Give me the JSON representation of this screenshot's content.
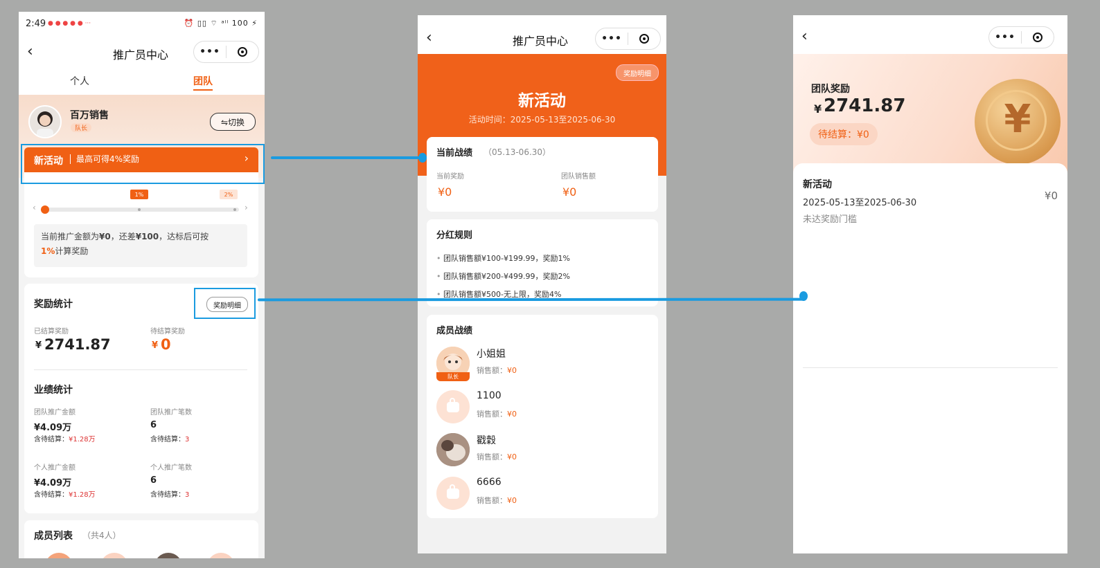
{
  "colors": {
    "accent": "#f06014",
    "highlight": "#1a9be0",
    "background": "#a9aaa9"
  },
  "p1": {
    "status_time": "2:49",
    "status_icons": "⏰ ▯▯ ⌔ ᵃˡˡ 100 ⚡",
    "nav": {
      "back_icon": "chevron-left-icon",
      "title": "推广员中心",
      "more": "•••"
    },
    "tabs": [
      {
        "label": "个人"
      },
      {
        "label": "团队"
      }
    ],
    "profile": {
      "name": "百万销售",
      "role_badge": "队长",
      "switch_label": "⇋切换"
    },
    "banner": {
      "title": "新活动",
      "subtitle": "最高可得4%奖励",
      "arrow": "›"
    },
    "progress": {
      "marker_1": "1%",
      "marker_2": "2%",
      "value": 0,
      "left_arrow": "‹",
      "right_arrow": "›"
    },
    "notice": {
      "line1_a": "当前推广金额为",
      "amount": "¥0",
      "line1_b": "，还差",
      "gap": "¥100",
      "line1_c": "，达标后可按",
      "rate": "1%",
      "line2": "计算奖励"
    },
    "reward_stats": {
      "title": "奖励统计",
      "detail_button": "奖励明细",
      "settled_label": "已结算奖励",
      "settled_currency": "¥",
      "settled_value": "2741.87",
      "pending_label": "待结算奖励",
      "pending_currency": "¥",
      "pending_value": "0"
    },
    "performance": {
      "title": "业绩统计",
      "team_amount_label": "团队推广金额",
      "team_amount": "¥4.09万",
      "team_amount_pending_label": "含待结算：",
      "team_amount_pending": "¥1.28万",
      "team_count_label": "团队推广笔数",
      "team_count": "6",
      "team_count_pending_label": "含待结算：",
      "team_count_pending": "3",
      "personal_amount_label": "个人推广金额",
      "personal_amount": "¥4.09万",
      "personal_amount_pending_label": "含待结算：",
      "personal_amount_pending": "¥1.28万",
      "personal_count_label": "个人推广笔数",
      "personal_count": "6",
      "personal_count_pending_label": "含待结算：",
      "personal_count_pending": "3"
    },
    "members": {
      "title": "成员列表",
      "count": "（共4人）"
    }
  },
  "p2": {
    "nav": {
      "title": "推广员中心",
      "more": "•••"
    },
    "header": {
      "detail_button": "奖励明细",
      "title": "新活动",
      "period": "活动时间：2025-05-13至2025-06-30"
    },
    "current": {
      "title": "当前战绩",
      "range": "（05.13-06.30）",
      "reward_label": "当前奖励",
      "reward_value": "¥0",
      "sales_label": "团队销售额",
      "sales_value": "¥0"
    },
    "rules": {
      "title": "分红规则",
      "items": [
        "团队销售额¥100-¥199.99，奖励1%",
        "团队销售额¥200-¥499.99，奖励2%",
        "团队销售额¥500-无上限，奖励4%"
      ]
    },
    "members": {
      "title": "成员战绩",
      "sales_label": "销售额：",
      "list": [
        {
          "name": "小姐姐",
          "sales": "¥0",
          "badge": "队长"
        },
        {
          "name": "1100",
          "sales": "¥0"
        },
        {
          "name": "戳穀",
          "sales": "¥0"
        },
        {
          "name": "6666",
          "sales": "¥0"
        }
      ]
    }
  },
  "p3": {
    "nav": {
      "more": "•••"
    },
    "header": {
      "title": "团队奖励",
      "currency": "¥",
      "amount": "2741.87",
      "pending": "待结算：¥0",
      "coin_symbol": "¥"
    },
    "record": {
      "title": "新活动",
      "period": "2025-05-13至2025-06-30",
      "status": "未达奖励门槛",
      "amount": "¥0"
    }
  }
}
